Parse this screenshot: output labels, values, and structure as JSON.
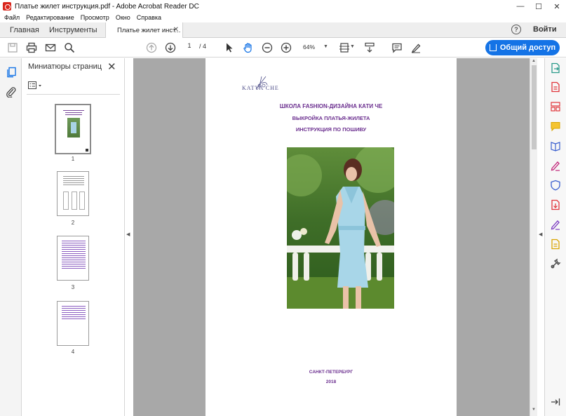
{
  "window": {
    "title": "Платье жилет инструкция.pdf - Adobe Acrobat Reader DC",
    "minimize": "—",
    "maximize": "☐",
    "close": "✕"
  },
  "menu": [
    "Файл",
    "Редактирование",
    "Просмотр",
    "Окно",
    "Справка"
  ],
  "tabs": {
    "home": "Главная",
    "tools": "Инструменты",
    "document": "Платье жилет инст...",
    "document_close": "✕"
  },
  "header": {
    "help": "?",
    "login": "Войти"
  },
  "toolbar": {
    "page_current": "1",
    "page_total": "/ 4",
    "zoom": "64%",
    "share_label": "Общий доступ"
  },
  "thumbnails": {
    "title": "Миниатюры страниц",
    "close": "✕",
    "pages": [
      "1",
      "2",
      "3",
      "4"
    ]
  },
  "document": {
    "logo_text": "KATYA CHE",
    "line1": "ШКОЛА FASHION-ДИЗАЙНА КАТИ ЧЕ",
    "line2": "ВЫКРОЙКА  ПЛАТЬЯ-ЖИЛЕТА",
    "line3": "ИНСТРУКЦИЯ ПО ПОШИВУ",
    "city": "САНКТ-ПЕТЕРБУРГ",
    "year": "2018"
  },
  "colors": {
    "accent": "#1473e6",
    "title_purple": "#6b2f8f",
    "canvas_gray": "#a8a8a8"
  }
}
